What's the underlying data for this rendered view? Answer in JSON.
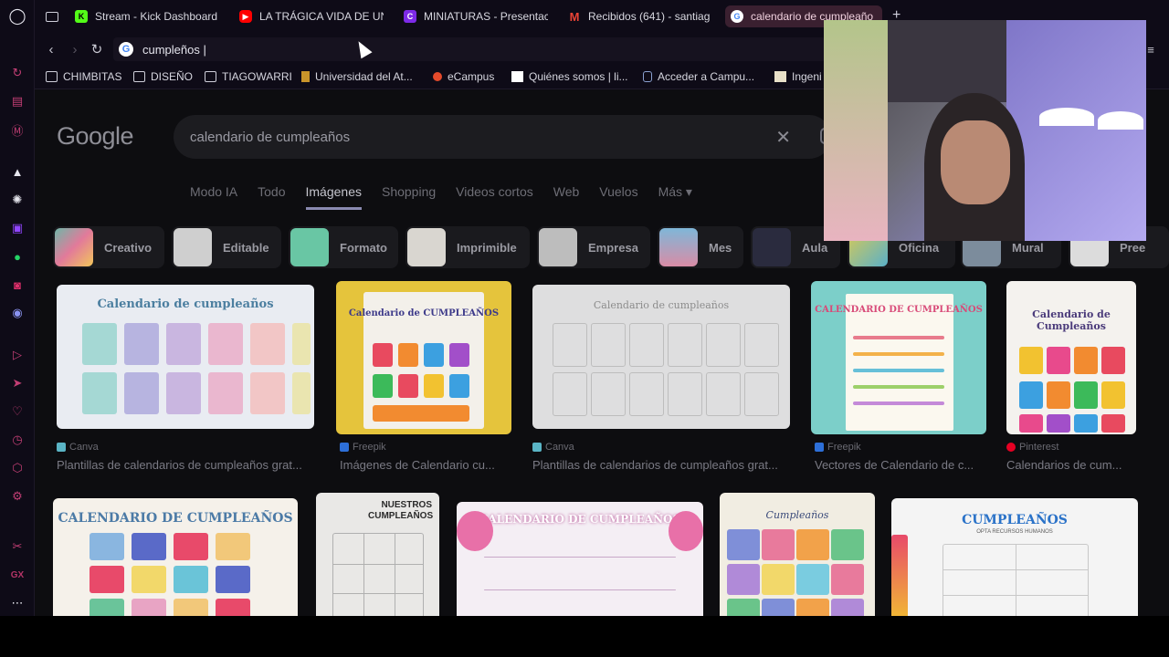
{
  "browser": {
    "tabs": [
      {
        "label": "Stream - Kick Dashboard",
        "icon": "kick-icon",
        "color": "#53fc18"
      },
      {
        "label": "LA TRÁGICA VIDA DE UN",
        "icon": "youtube-icon",
        "color": "#ff0000"
      },
      {
        "label": "MINIATURAS - Presentac",
        "icon": "canva-icon",
        "color": "#7d2ae8"
      },
      {
        "label": "Recibidos (641) - santiag",
        "icon": "gmail-icon",
        "color": "#ea4335"
      },
      {
        "label": "calendario de cumpleaño",
        "icon": "google-icon",
        "color": "#4285f4",
        "active": true
      }
    ],
    "address": "cumpleños |",
    "bookmarks": [
      {
        "label": "CHIMBITAS",
        "icon": "folder-icon"
      },
      {
        "label": "DISEÑO",
        "icon": "folder-icon"
      },
      {
        "label": "TIAGOWARRI",
        "icon": "folder-icon"
      },
      {
        "label": "Universidad del At...",
        "icon": "university-icon"
      },
      {
        "label": "eCampus",
        "icon": "ecampus-icon"
      },
      {
        "label": "Quiénes somos | li...",
        "icon": "wix-icon"
      },
      {
        "label": "Acceder a Campu...",
        "icon": "campus-icon"
      },
      {
        "label": "Ingeni",
        "icon": "page-icon"
      }
    ]
  },
  "google": {
    "logo": "Google",
    "query": "calendario de cumpleaños",
    "filters": [
      "Modo IA",
      "Todo",
      "Imágenes",
      "Shopping",
      "Videos cortos",
      "Web",
      "Vuelos",
      "Más ▾"
    ],
    "active_filter": "Imágenes",
    "chips": [
      "Creativo",
      "Editable",
      "Formato",
      "Imprimible",
      "Empresa",
      "Mes",
      "Aula",
      "Oficina",
      "Mural",
      "Pree"
    ],
    "results_row1": [
      {
        "source": "Canva",
        "title": "Plantillas de calendarios de cumpleaños grat...",
        "image_text": "Calendario de cumpleaños"
      },
      {
        "source": "Freepik",
        "title": "Imágenes de Calendario cu...",
        "image_text": "Calendario de CUMPLEAÑOS"
      },
      {
        "source": "Canva",
        "title": "Plantillas de calendarios de cumpleaños grat...",
        "image_text": "Calendario de cumpleaños"
      },
      {
        "source": "Freepik",
        "title": "Vectores de Calendario de c...",
        "image_text": "CALENDARIO DE CUMPLEAÑOS"
      },
      {
        "source": "Pinterest",
        "title": "Calendarios de cum...",
        "image_text": "Calendario de Cumpleaños"
      }
    ],
    "results_row2": [
      {
        "image_text": "CALENDARIO DE CUMPLEAÑOS"
      },
      {
        "image_text": "NUESTROS CUMPLEAÑOS"
      },
      {
        "image_text": "CALENDARIO DE CUMPLEAÑOS"
      },
      {
        "image_text": "Cumpleaños"
      },
      {
        "image_text": "CUMPLEAÑOS",
        "image_subtext": "OPTA RECURSOS HUMANOS"
      }
    ]
  },
  "sidebar_icons": [
    "opera-gx-logo-icon",
    "speed-dial-icon",
    "news-icon",
    "m-icon",
    "aria-icon",
    "chatgpt-icon",
    "twitch-icon",
    "whatsapp-icon",
    "instagram-icon",
    "discord-icon",
    "player-icon",
    "send-icon",
    "heart-icon",
    "history-icon",
    "extensions-icon",
    "settings-icon",
    "gx-icon",
    "more-icon"
  ],
  "colors": {
    "accent": "#c13e74",
    "page_bg": "#0d0d10"
  }
}
